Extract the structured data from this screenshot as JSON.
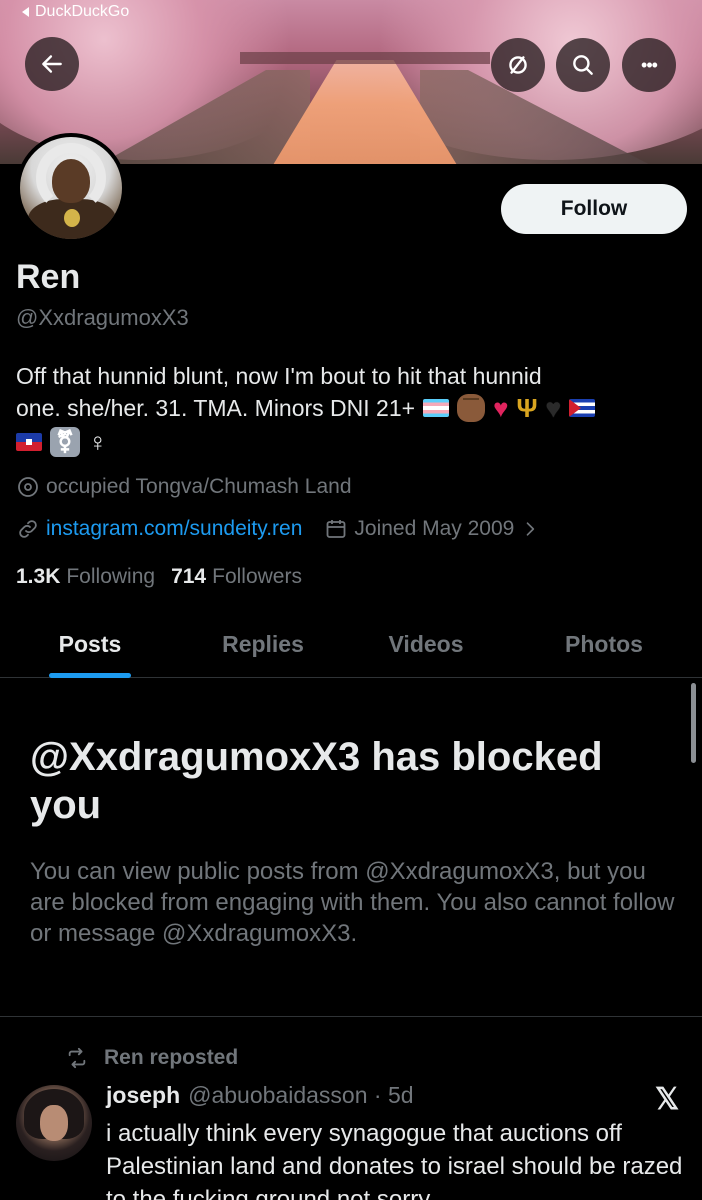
{
  "status_bar": {
    "back_app": "DuckDuckGo"
  },
  "header_icons": [
    "arrow-left-icon",
    "mute-icon",
    "search-icon",
    "more-icon"
  ],
  "header_more_glyph": "•••",
  "profile": {
    "display_name": "Ren",
    "handle": "@XxdragumoxX3",
    "follow_label": "Follow",
    "bio_line1": "Off that hunnid blunt, now I'm bout to hit that hunnid",
    "bio_line2_text": "one. she/her. 31. TMA. Minors DNI 21+",
    "bio_line2_emojis": [
      "transgender-flag",
      "raised-fist-medium-dark",
      "red-heart",
      "trident",
      "black-heart",
      "cuba-flag"
    ],
    "bio_line3_emojis": [
      "haiti-flag",
      "transgender-symbol",
      "female-sign"
    ],
    "location": "occupied Tongva/Chumash Land",
    "website": "instagram.com/sundeity.ren",
    "joined": "Joined May 2009",
    "following_count": "1.3K",
    "following_label": "Following",
    "followers_count": "714",
    "followers_label": "Followers"
  },
  "tabs": [
    {
      "label": "Posts",
      "active": true
    },
    {
      "label": "Replies",
      "active": false
    },
    {
      "label": "Videos",
      "active": false
    },
    {
      "label": "Photos",
      "active": false
    }
  ],
  "blocked_notice": {
    "title": "@XxdragumoxX3 has blocked you",
    "body": "You can view public posts from @XxdragumoxX3, but you are blocked from engaging with them. You also cannot follow or message @XxdragumoxX3."
  },
  "post": {
    "repost_label": "Ren reposted",
    "author_name": "joseph",
    "author_handle": "@abuobaidasson",
    "time": "5d",
    "text": "i actually think every synagogue that auctions off Palestinian land and donates to israel should be razed to the fucking ground not sorry"
  },
  "colors": {
    "accent": "#1d9bf0",
    "background": "#000000",
    "secondary_text": "#71767b",
    "primary_text": "#e7e9ea"
  }
}
